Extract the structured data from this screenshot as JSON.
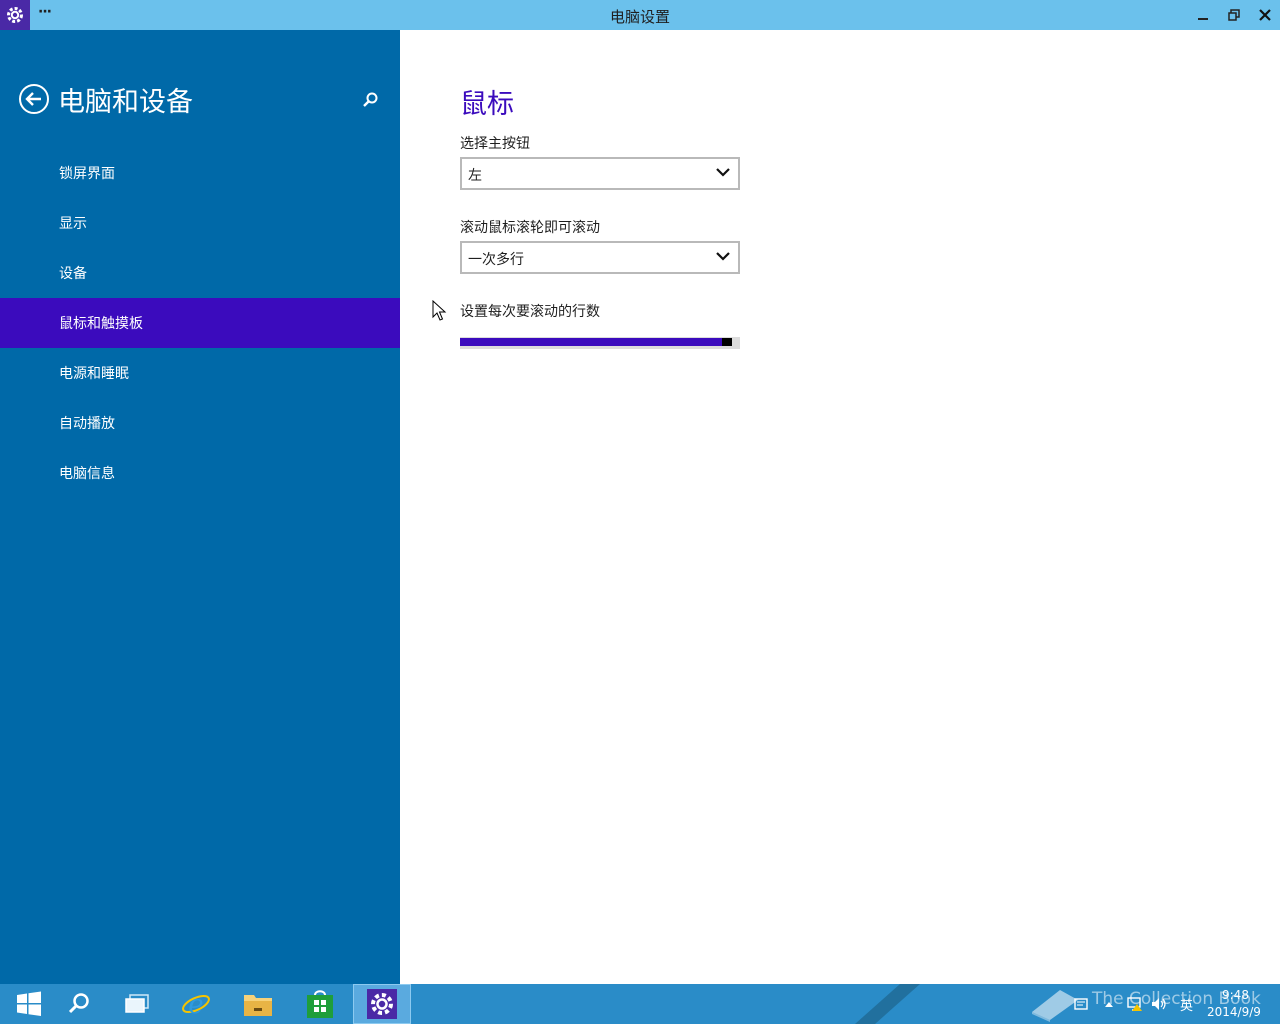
{
  "window": {
    "title": "电脑设置",
    "menu_label": "···"
  },
  "sidebar": {
    "title": "电脑和设备",
    "items": [
      {
        "label": "锁屏界面"
      },
      {
        "label": "显示"
      },
      {
        "label": "设备"
      },
      {
        "label": "鼠标和触摸板",
        "active": true
      },
      {
        "label": "电源和睡眠"
      },
      {
        "label": "自动播放"
      },
      {
        "label": "电脑信息"
      }
    ]
  },
  "main": {
    "title": "鼠标",
    "primary_button": {
      "label": "选择主按钮",
      "value": "左"
    },
    "wheel_scroll": {
      "label": "滚动鼠标滚轮即可滚动",
      "value": "一次多行"
    },
    "lines_slider": {
      "label": "设置每次要滚动的行数",
      "value_fraction": 0.97
    }
  },
  "taskbar": {
    "watermark": "The Collection Book",
    "ime": "英",
    "time": "9:48",
    "date": "2014/9/9"
  },
  "colors": {
    "accent": "#3b0bbd",
    "sidebar_bg": "#0069a8",
    "titlebar_bg": "#6bc1ec",
    "taskbar_bg": "#2a8cc8"
  }
}
